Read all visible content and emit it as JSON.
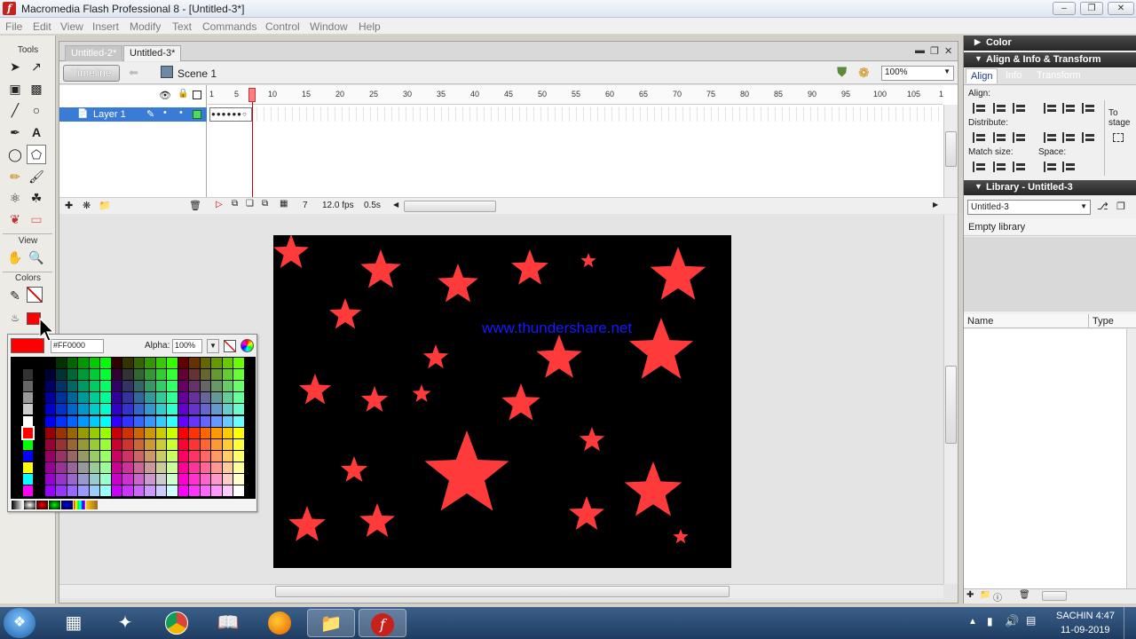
{
  "window": {
    "title": "Macromedia Flash Professional 8 - [Untitled-3*]"
  },
  "menu": [
    "File",
    "Edit",
    "View",
    "Insert",
    "Modify",
    "Text",
    "Commands",
    "Control",
    "Window",
    "Help"
  ],
  "tools": {
    "label": "Tools",
    "view_label": "View",
    "colors_label": "Colors"
  },
  "document": {
    "tabs": [
      "Untitled-2*",
      "Untitled-3*"
    ],
    "timeline_button": "Timeline",
    "scene": "Scene 1",
    "zoom": "100%"
  },
  "timeline": {
    "frame_numbers": [
      "1",
      "5",
      "10",
      "15",
      "20",
      "25",
      "30",
      "35",
      "40",
      "45",
      "50",
      "55",
      "60",
      "65",
      "70",
      "75",
      "80",
      "85",
      "90",
      "95",
      "100",
      "105",
      "1"
    ],
    "layer_name": "Layer 1",
    "current_frame": "7",
    "fps": "12.0 fps",
    "time": "0.5s"
  },
  "stage": {
    "watermark": "www.thundershare.net",
    "background": "#000000",
    "star_color": "#ff3a3a"
  },
  "color_popup": {
    "hex": "#FF0000",
    "alpha_label": "Alpha:",
    "alpha_value": "100%",
    "selected_color": "#ff0000"
  },
  "panels": {
    "color": "Color",
    "align_group": "Align & Info & Transform",
    "tabs": [
      "Align",
      "Info",
      "Transform"
    ],
    "align_label": "Align:",
    "distribute_label": "Distribute:",
    "match_size_label": "Match size:",
    "space_label": "Space:",
    "to_stage_line1": "To",
    "to_stage_line2": "stage",
    "library_title": "Library - Untitled-3",
    "library_select": "Untitled-3",
    "empty_library": "Empty library",
    "col_name": "Name",
    "col_type": "Type"
  },
  "taskbar": {
    "user_time": "SACHIN 4:47",
    "date": "11-09-2019"
  }
}
